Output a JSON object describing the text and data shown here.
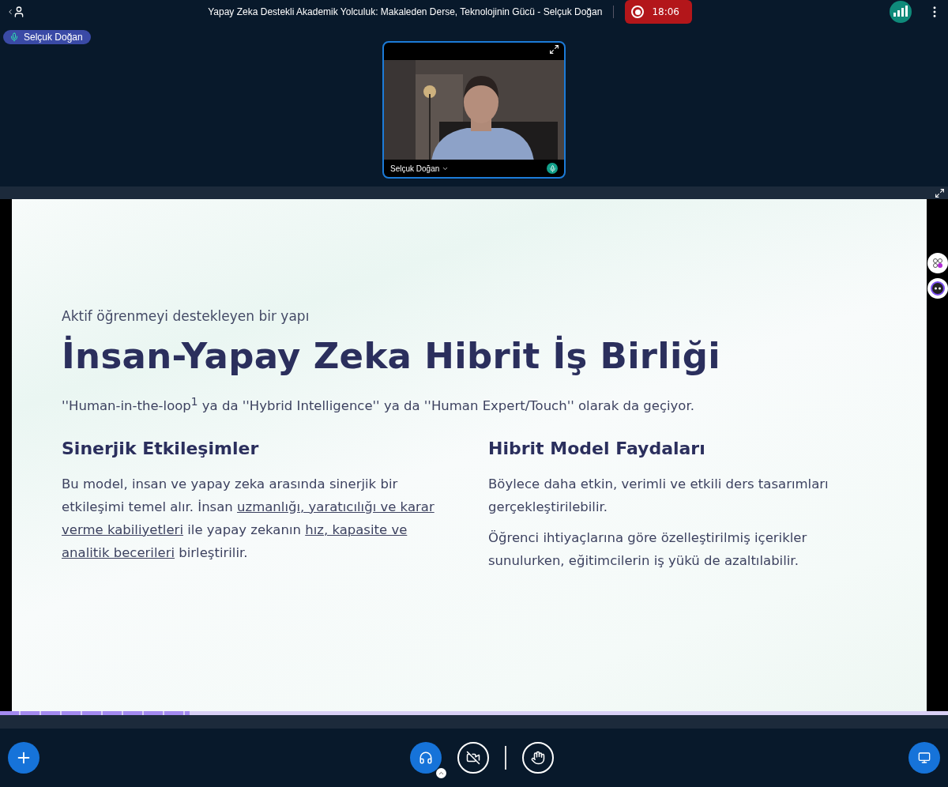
{
  "header": {
    "title": "Yapay Zeka Destekli Akademik Yolculuk: Makaleden Derse, Teknolojinin Gücü - Selçuk Doğan",
    "recording": {
      "on": true,
      "time": "18:06"
    }
  },
  "presenter_badge": {
    "name": "Selçuk Doğan"
  },
  "video_tile": {
    "name": "Selçuk Doğan"
  },
  "slide": {
    "kicker": "Aktif öğrenmeyi destekleyen bir yapı",
    "title": "İnsan-Yapay Zeka Hibrit İş Birliği",
    "subtitle": "''Human-in-the-loop$^{1}$ ya da ''Hybrid Intelligence'' ya da ''Human Expert/Touch'' olarak da geçiyor.",
    "columns": [
      {
        "heading": "Sinerjik Etkileşimler",
        "paragraphs": [
          [
            {
              "text": "Bu model, insan ve yapay zeka arasında sinerjik bir etkileşimi temel alır. İnsan ",
              "underlined": false
            },
            {
              "text": "uzmanlığı, yaratıcılığı ve karar verme kabiliyetleri",
              "underlined": true
            },
            {
              "text": " ile yapay zekanın ",
              "underlined": false
            },
            {
              "text": "hız, kapasite ve analitik becerileri",
              "underlined": true
            },
            {
              "text": " birleştirilir.",
              "underlined": false
            }
          ]
        ]
      },
      {
        "heading": "Hibrit Model Faydaları",
        "paragraphs": [
          [
            {
              "text": "Böylece daha etkin, verimli ve etkili ders tasarımları gerçekleştirilebilir.",
              "underlined": false
            }
          ],
          [
            {
              "text": "Öğrenci ihtiyaçlarına göre özelleştirilmiş içerikler sunulurken, eğitimcilerin iş yükü de azaltılabilir.",
              "underlined": false
            }
          ]
        ]
      }
    ]
  },
  "slide_progress": {
    "level": 0.2
  }
}
